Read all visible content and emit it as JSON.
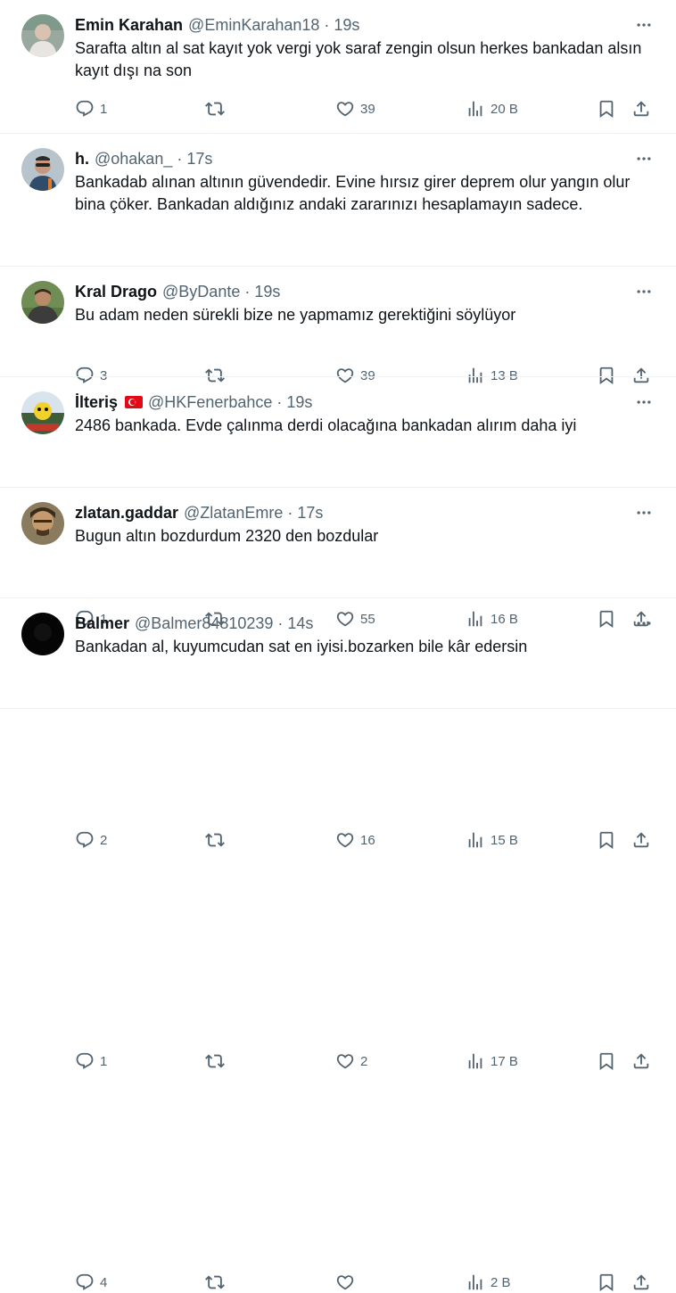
{
  "tweets": [
    {
      "name": "Emin Karahan",
      "handle": "@EminKarahan18",
      "time": "19s",
      "text": "Sarafta altın al sat kayıt yok vergi yok saraf zengin olsun herkes bankadan alsın kayıt dışı na son",
      "replies": "1",
      "retweets": "",
      "likes": "39",
      "views": "20 B",
      "flag": false
    },
    {
      "name": "h.",
      "handle": "@ohakan_",
      "time": "17s",
      "text": "Bankadab alınan altının güvendedir. Evine hırsız girer deprem olur yangın olur bina çöker. Bankadan aldığınız andaki zararınızı hesaplamayın sadece.",
      "replies": "3",
      "retweets": "",
      "likes": "39",
      "views": "13 B",
      "flag": false
    },
    {
      "name": "Kral Drago",
      "handle": "@ByDante",
      "time": "19s",
      "text": "Bu adam neden sürekli bize ne yapmamız gerektiğini söylüyor",
      "replies": "1",
      "retweets": "",
      "likes": "55",
      "views": "16 B",
      "flag": false
    },
    {
      "name": "İlteriş",
      "handle": "@HKFenerbahce",
      "time": "19s",
      "text": "2486 bankada. Evde çalınma derdi olacağına bankadan alırım daha iyi",
      "replies": "2",
      "retweets": "",
      "likes": "16",
      "views": "15 B",
      "flag": true
    },
    {
      "name": "zlatan.gaddar",
      "handle": "@ZlatanEmre",
      "time": "17s",
      "text": "Bugun altın bozdurdum 2320  den bozdular",
      "replies": "1",
      "retweets": "",
      "likes": "2",
      "views": "17 B",
      "flag": false
    },
    {
      "name": "Balmer",
      "handle": "@Balmer84810239",
      "time": "14s",
      "text": "Bankadan al, kuyumcudan sat en iyisi.bozarken bile kâr edersin",
      "replies": "4",
      "retweets": "",
      "likes": "",
      "views": "2 B",
      "flag": false
    }
  ],
  "icons": {
    "reply": "reply-icon",
    "retweet": "retweet-icon",
    "like": "heart-icon",
    "views": "views-icon",
    "bookmark": "bookmark-icon",
    "share": "share-icon",
    "more": "more-icon"
  },
  "colors": {
    "text": "#0f1419",
    "secondary": "#536471",
    "divider": "#eff3f4",
    "flag": "#e30a17"
  }
}
